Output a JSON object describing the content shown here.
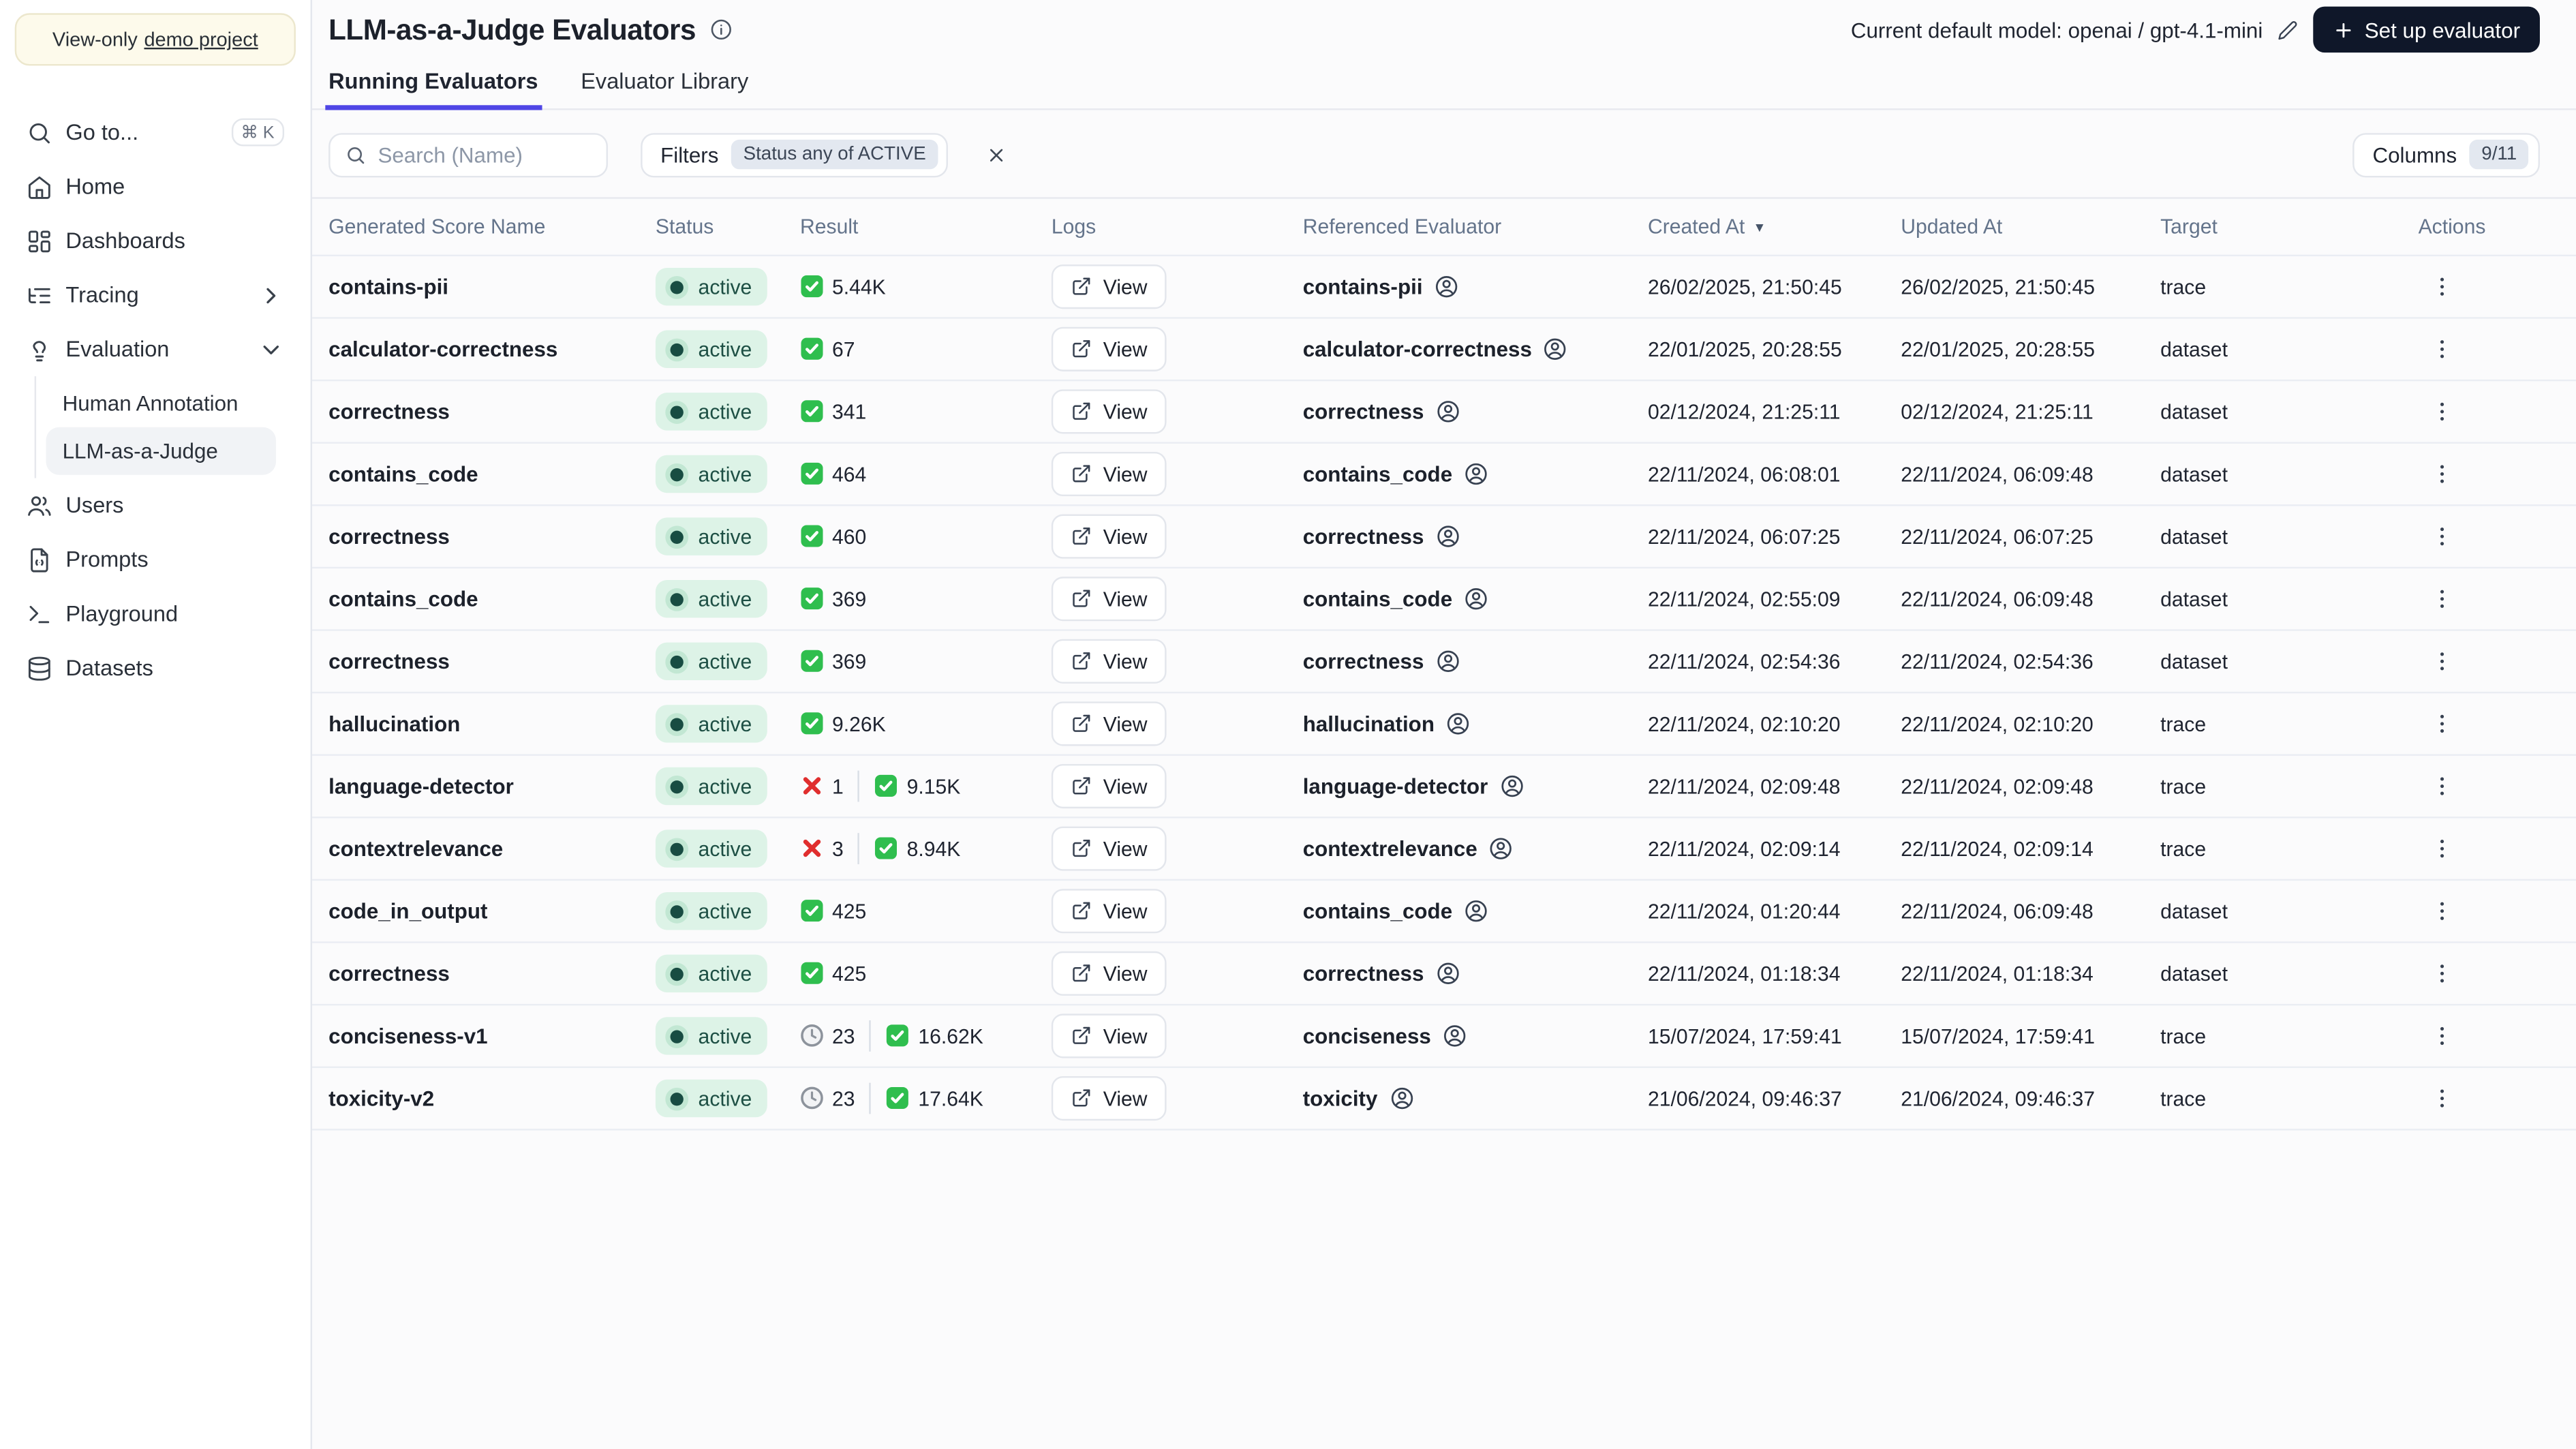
{
  "banner": {
    "prefix": "View-only",
    "link": "demo project"
  },
  "sidebar": {
    "goto_label": "Go to...",
    "goto_shortcut": "⌘ K",
    "home": "Home",
    "dashboards": "Dashboards",
    "tracing": "Tracing",
    "evaluation": "Evaluation",
    "human_annotation": "Human Annotation",
    "llm_judge": "LLM-as-a-Judge",
    "users": "Users",
    "prompts": "Prompts",
    "playground": "Playground",
    "datasets": "Datasets"
  },
  "header": {
    "title": "LLM-as-a-Judge Evaluators",
    "model_label": "Current default model: openai / gpt-4.1-mini",
    "setup_button_label": "Set up evaluator"
  },
  "tabs": {
    "running": "Running Evaluators",
    "library": "Evaluator Library"
  },
  "toolbar": {
    "search_placeholder": "Search (Name)",
    "filters_label": "Filters",
    "filter_chip": "Status any of ACTIVE",
    "columns_label": "Columns",
    "columns_badge": "9/11"
  },
  "table": {
    "columns": [
      "Generated Score Name",
      "Status",
      "Result",
      "Logs",
      "Referenced Evaluator",
      "Created At",
      "Updated At",
      "Target",
      "Actions"
    ],
    "sorted_column": "Created At",
    "sort_direction": "desc",
    "view_label": "View",
    "rows": [
      {
        "name": "contains-pii",
        "status": "active",
        "result": [
          {
            "type": "success",
            "value": "5.44K"
          }
        ],
        "referenced": "contains-pii",
        "created_at": "26/02/2025, 21:50:45",
        "updated_at": "26/02/2025, 21:50:45",
        "target": "trace"
      },
      {
        "name": "calculator-correctness",
        "status": "active",
        "result": [
          {
            "type": "success",
            "value": "67"
          }
        ],
        "referenced": "calculator-correctness",
        "created_at": "22/01/2025, 20:28:55",
        "updated_at": "22/01/2025, 20:28:55",
        "target": "dataset"
      },
      {
        "name": "correctness",
        "status": "active",
        "result": [
          {
            "type": "success",
            "value": "341"
          }
        ],
        "referenced": "correctness",
        "created_at": "02/12/2024, 21:25:11",
        "updated_at": "02/12/2024, 21:25:11",
        "target": "dataset"
      },
      {
        "name": "contains_code",
        "status": "active",
        "result": [
          {
            "type": "success",
            "value": "464"
          }
        ],
        "referenced": "contains_code",
        "created_at": "22/11/2024, 06:08:01",
        "updated_at": "22/11/2024, 06:09:48",
        "target": "dataset"
      },
      {
        "name": "correctness",
        "status": "active",
        "result": [
          {
            "type": "success",
            "value": "460"
          }
        ],
        "referenced": "correctness",
        "created_at": "22/11/2024, 06:07:25",
        "updated_at": "22/11/2024, 06:07:25",
        "target": "dataset"
      },
      {
        "name": "contains_code",
        "status": "active",
        "result": [
          {
            "type": "success",
            "value": "369"
          }
        ],
        "referenced": "contains_code",
        "created_at": "22/11/2024, 02:55:09",
        "updated_at": "22/11/2024, 06:09:48",
        "target": "dataset"
      },
      {
        "name": "correctness",
        "status": "active",
        "result": [
          {
            "type": "success",
            "value": "369"
          }
        ],
        "referenced": "correctness",
        "created_at": "22/11/2024, 02:54:36",
        "updated_at": "22/11/2024, 02:54:36",
        "target": "dataset"
      },
      {
        "name": "hallucination",
        "status": "active",
        "result": [
          {
            "type": "success",
            "value": "9.26K"
          }
        ],
        "referenced": "hallucination",
        "created_at": "22/11/2024, 02:10:20",
        "updated_at": "22/11/2024, 02:10:20",
        "target": "trace"
      },
      {
        "name": "language-detector",
        "status": "active",
        "result": [
          {
            "type": "error",
            "value": "1"
          },
          {
            "type": "success",
            "value": "9.15K"
          }
        ],
        "referenced": "language-detector",
        "created_at": "22/11/2024, 02:09:48",
        "updated_at": "22/11/2024, 02:09:48",
        "target": "trace"
      },
      {
        "name": "contextrelevance",
        "status": "active",
        "result": [
          {
            "type": "error",
            "value": "3"
          },
          {
            "type": "success",
            "value": "8.94K"
          }
        ],
        "referenced": "contextrelevance",
        "created_at": "22/11/2024, 02:09:14",
        "updated_at": "22/11/2024, 02:09:14",
        "target": "trace"
      },
      {
        "name": "code_in_output",
        "status": "active",
        "result": [
          {
            "type": "success",
            "value": "425"
          }
        ],
        "referenced": "contains_code",
        "created_at": "22/11/2024, 01:20:44",
        "updated_at": "22/11/2024, 06:09:48",
        "target": "dataset"
      },
      {
        "name": "correctness",
        "status": "active",
        "result": [
          {
            "type": "success",
            "value": "425"
          }
        ],
        "referenced": "correctness",
        "created_at": "22/11/2024, 01:18:34",
        "updated_at": "22/11/2024, 01:18:34",
        "target": "dataset"
      },
      {
        "name": "conciseness-v1",
        "status": "active",
        "result": [
          {
            "type": "pending",
            "value": "23"
          },
          {
            "type": "success",
            "value": "16.62K"
          }
        ],
        "referenced": "conciseness",
        "created_at": "15/07/2024, 17:59:41",
        "updated_at": "15/07/2024, 17:59:41",
        "target": "trace"
      },
      {
        "name": "toxicity-v2",
        "status": "active",
        "result": [
          {
            "type": "pending",
            "value": "23"
          },
          {
            "type": "success",
            "value": "17.64K"
          }
        ],
        "referenced": "toxicity",
        "created_at": "21/06/2024, 09:46:37",
        "updated_at": "21/06/2024, 09:46:37",
        "target": "trace"
      }
    ]
  },
  "colors": {
    "accent": "#4f46e5",
    "active_badge_bg": "#ddf3e7",
    "active_badge_text": "#1d4f44",
    "success_green": "#2fbe4e",
    "error_red": "#e02e2e",
    "pending_gray": "#8d939c",
    "primary_button_bg": "#0f1729",
    "banner_bg": "#fdfaeb"
  }
}
